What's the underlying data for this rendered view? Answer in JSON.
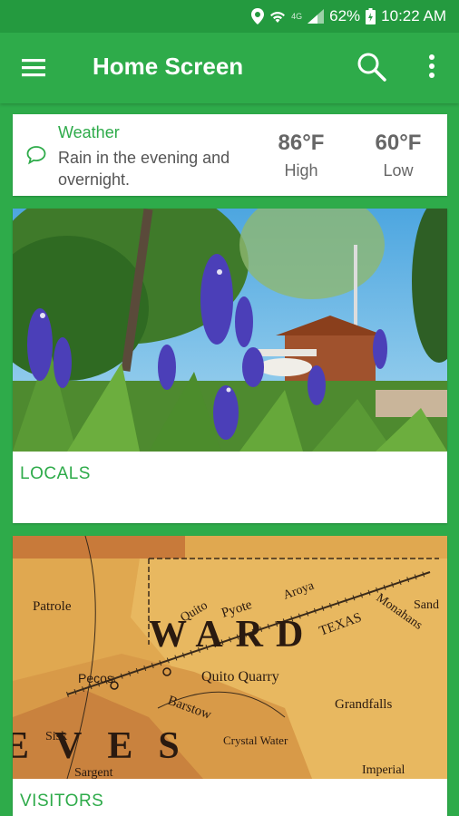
{
  "status_bar": {
    "network": "4G",
    "battery": "62%",
    "time": "10:22 AM"
  },
  "app_bar": {
    "title": "Home Screen",
    "icons": [
      "menu-icon",
      "search-icon",
      "more-vert-icon"
    ]
  },
  "weather": {
    "title": "Weather",
    "description": "Rain in the evening and overnight.",
    "high_value": "86°F",
    "high_label": "High",
    "low_value": "60°F",
    "low_label": "Low",
    "icon": "chat-bubble-icon"
  },
  "cards": {
    "locals": {
      "label": "LOCALS",
      "image": "bluebonnet-garden-photo"
    },
    "visitors": {
      "label": "VISITORS",
      "image": "antique-map-photo",
      "map_text": {
        "county": "WARD",
        "county_partial": "EVES",
        "state": "TEXAS",
        "towns": [
          "Pecos",
          "Patrole",
          "Pyote",
          "Quito",
          "Quito Quarry",
          "Barstow",
          "Aroya",
          "Monahans",
          "Grandfalls",
          "Sisk",
          "Sargent",
          "Crystal Water",
          "Imperial",
          "Sand"
        ]
      }
    }
  },
  "colors": {
    "primary": "#2eab4a",
    "status_bar": "#249a3f",
    "card": "#ffffff",
    "text_muted": "#555555"
  }
}
